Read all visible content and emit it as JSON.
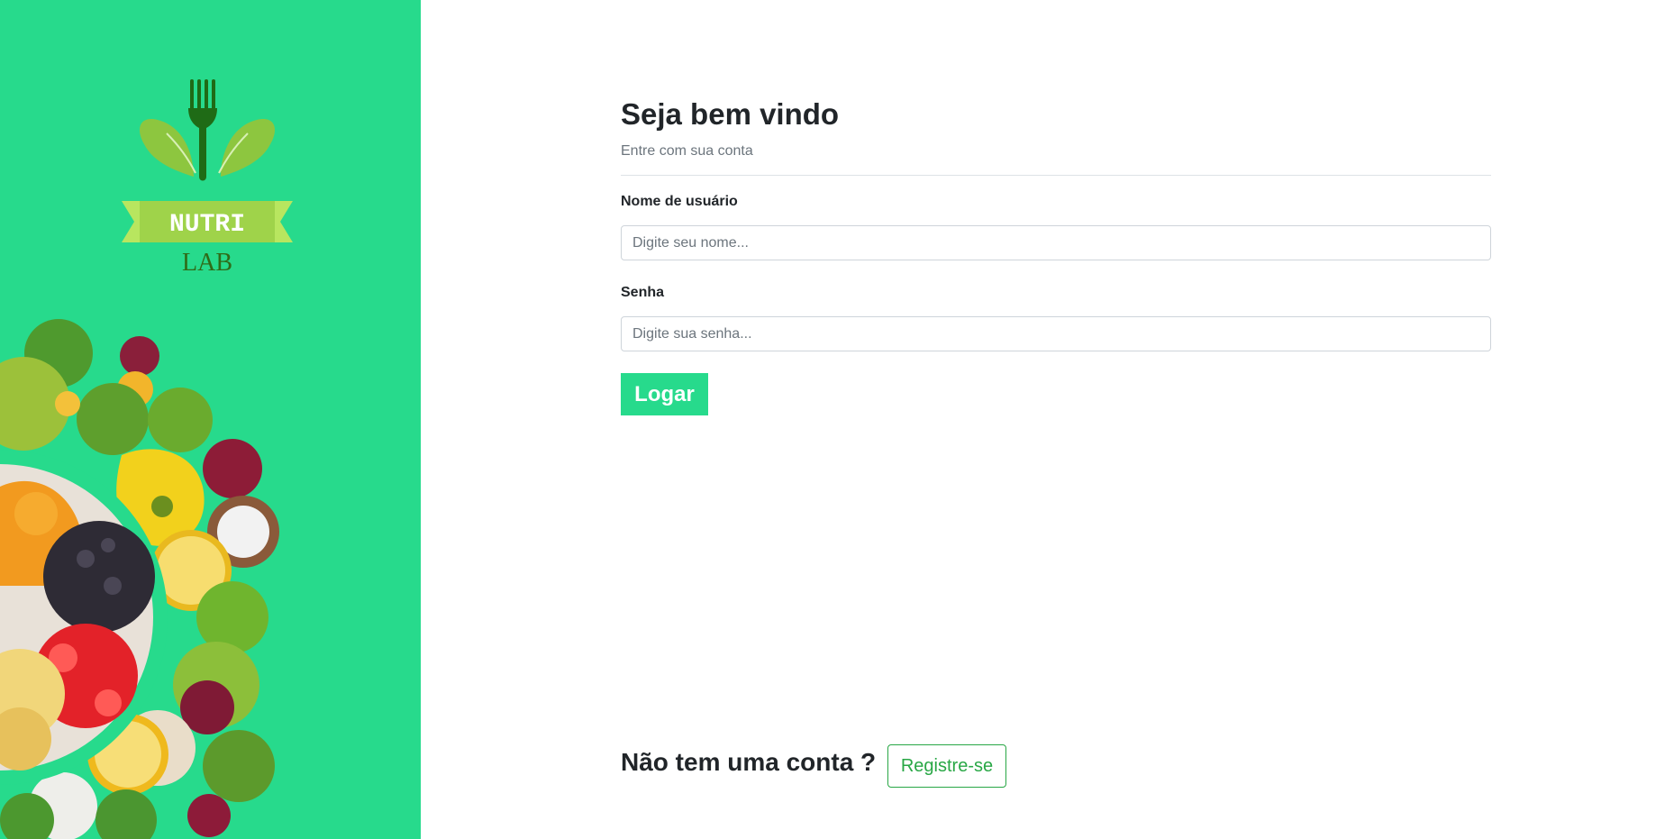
{
  "brand": {
    "name_line1": "NUTRI",
    "name_line2": "LAB",
    "panel_color": "#27da8c"
  },
  "login": {
    "title": "Seja bem vindo",
    "subtitle": "Entre com sua conta",
    "username_label": "Nome de usuário",
    "username_placeholder": "Digite seu nome...",
    "username_value": "",
    "password_label": "Senha",
    "password_placeholder": "Digite sua senha...",
    "password_value": "",
    "submit_label": "Logar"
  },
  "register": {
    "prompt": "Não tem uma conta ?",
    "button_label": "Registre-se"
  },
  "icons": [
    "fork-leaf-logo-icon",
    "fruit-vegetable-illustration"
  ],
  "colors": {
    "accent": "#27da8c",
    "register_outline": "#28a745"
  }
}
